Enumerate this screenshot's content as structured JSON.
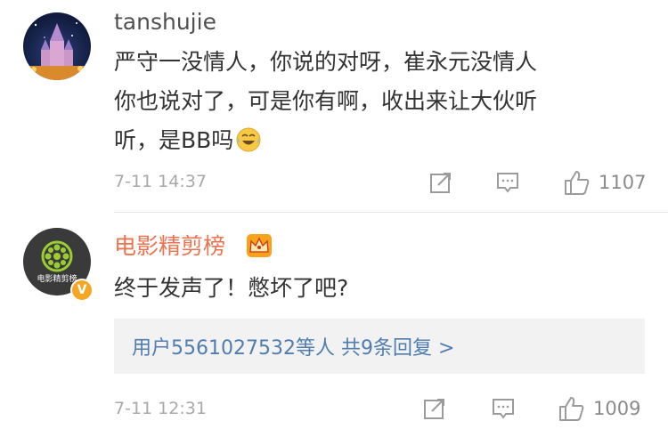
{
  "comments": [
    {
      "username": "tanshujie",
      "lines": [
        "严守一没情人，你说的对呀，崔永元没情人",
        "你也说对了，可是你有啊，收出来让大伙听",
        "听，是BB吗"
      ],
      "time": "7-11 14:37",
      "likes": "1107",
      "avatar_icon": "castle-night-avatar",
      "emoji_icon": "laughing-tears-emoji"
    },
    {
      "username": "电影精剪榜",
      "lines": [
        "终于发声了！憋坏了吧?"
      ],
      "reply_summary": "用户5561027532等人  共9条回复 >",
      "time": "7-11 12:31",
      "likes": "1009",
      "avatar_caption": "电影精剪榜",
      "avatar_icon": "film-reel-avatar",
      "verified_icon": "verified-v-badge",
      "username_badge_icon": "crown-icon"
    }
  ],
  "colors": {
    "username_highlight": "#eb7350",
    "link_blue": "#507daf",
    "meta_gray": "#a8a8a8",
    "verified_orange": "#f5a623"
  }
}
